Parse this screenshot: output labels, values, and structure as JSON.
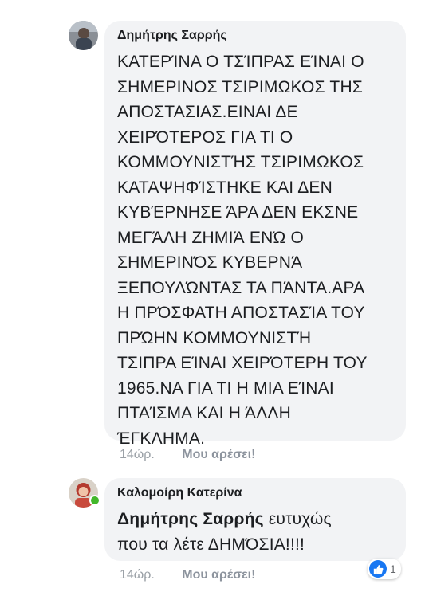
{
  "comments": [
    {
      "author": "Δημήτρης Σαρρής",
      "lines": [
        "ΚΑΤΕΡΊΝΑ  Ο ΤΣΊΠΡΑΣ ΕΊΝΑΙ Ο",
        "ΣΗΜΕΡΙΝΟΣ ΤΣΙΡΙΜΩΚΟΣ ΤΗΣ",
        "ΑΠΟΣΤΑΣΙΑΣ.ΕΙΝΑΙ ΔΕ",
        "ΧΕΙΡΌΤΕΡΟΣ ΓΙΑ ΤΙ Ο",
        "ΚΟΜΜΟΥΝΙΣΤΉΣ  ΤΣΙΡΙΜΩΚΟΣ",
        "ΚΑΤΑΨΗΦΊΣΤΗΚΕ ΚΑΙ ΔΕΝ",
        "ΚΥΒΈΡΝΗΣΕ ΆΡΑ ΔΕΝ ΕΚΣΝΕ",
        "ΜΕΓΆΛΗ ΖΗΜΙΆ ΕΝΏ Ο",
        "ΣΗΜΕΡΙΝΌΣ ΚΥΒΕΡΝΆ",
        "ΞΕΠΟΥΛΏΝΤΑΣ ΤΑ ΠΆΝΤΑ.ΑΡΑ",
        "Η ΠΡΌΣΦΑΤΗ ΑΠΟΣΤΑΣΊΑ ΤΟΥ",
        "ΠΡΏΗΝ ΚΟΜΜΟΥΝΙΣΤΉ",
        "ΤΣΙΠΡΑ ΕΊΝΑΙ ΧΕΙΡΌΤΕΡΗ ΤΟΥ",
        "1965.ΝΑ ΓΙΑ ΤΙ Η ΜΙΑ ΕΊΝΑΙ",
        "ΠΤΑΊΣΜΑ ΚΑΙ Η ΆΛΛΗ",
        "ΈΓΚΛΗΜΑ."
      ],
      "time": "14ώρ.",
      "like_label": "Μου αρέσει!"
    },
    {
      "author": "Καλομοίρη Κατερίνα",
      "mention": "Δημήτρης Σαρρής",
      "line1_rest": " ευτυχώς",
      "line2": "που τα λέτε ΔΗΜΌΣΙΑ!!!!",
      "time": "14ώρ.",
      "like_label": "Μου αρέσει!",
      "reaction_count": "1"
    }
  ],
  "colors": {
    "bubble": "#f2f3f5",
    "text": "#1c1e21",
    "meta": "#8d949e",
    "like_blue": "#1877f2",
    "online_green": "#42b72a"
  },
  "icons": [
    "avatar",
    "online-status-dot",
    "like-reaction-icon"
  ]
}
